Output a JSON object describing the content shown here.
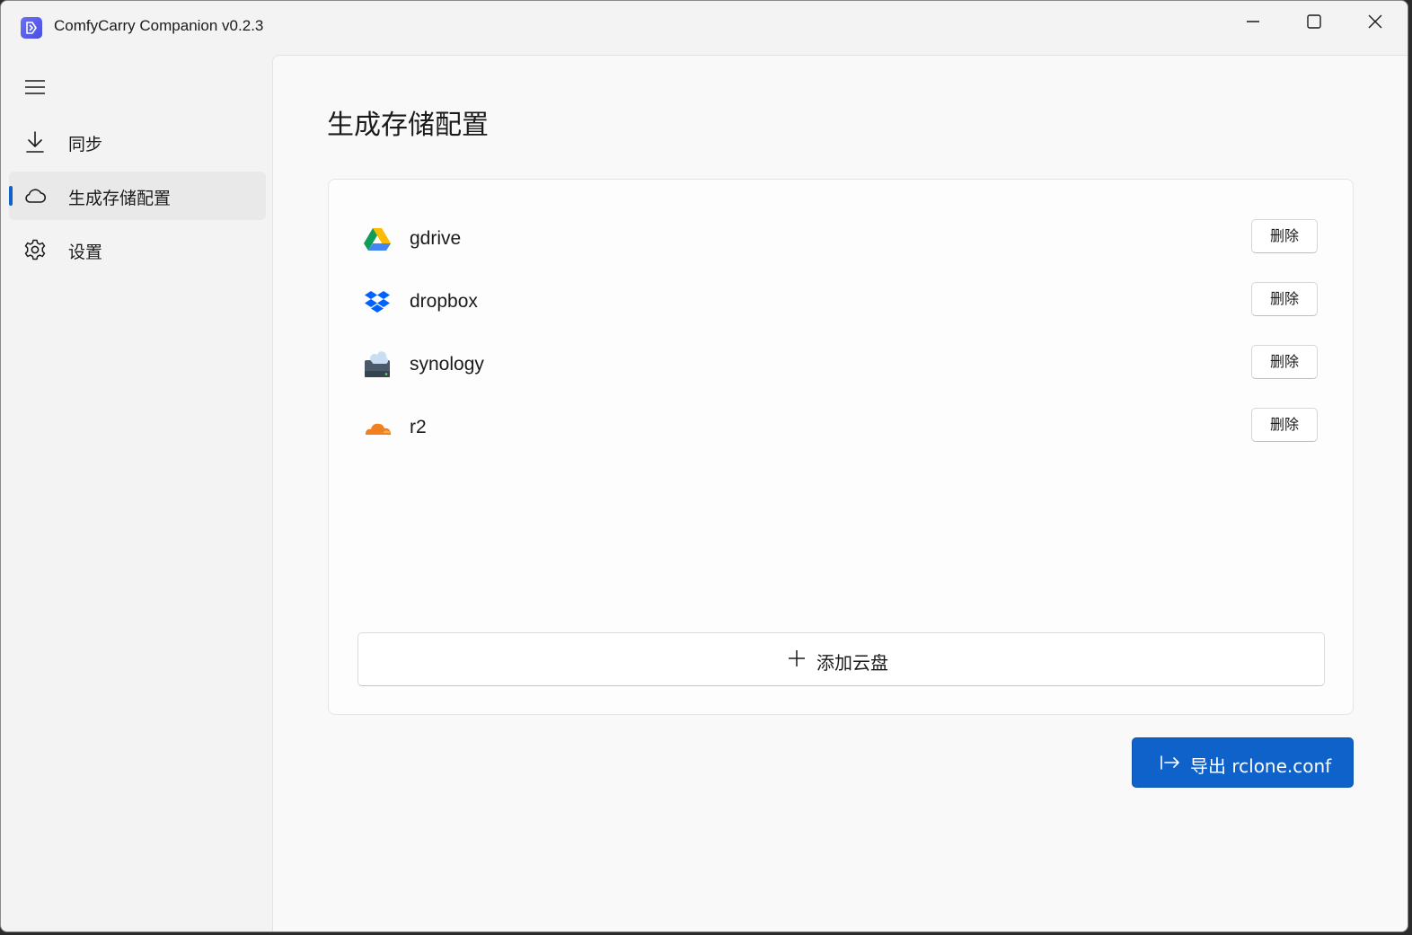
{
  "window": {
    "title": "ComfyCarry Companion v0.2.3"
  },
  "sidebar": {
    "items": [
      {
        "label": "同步",
        "icon": "download-icon",
        "active": false
      },
      {
        "label": "生成存储配置",
        "icon": "cloud-icon",
        "active": true
      },
      {
        "label": "设置",
        "icon": "gear-icon",
        "active": false
      }
    ]
  },
  "main": {
    "title": "生成存储配置",
    "remotes": [
      {
        "name": "gdrive",
        "icon": "google-drive-icon",
        "delete_label": "删除"
      },
      {
        "name": "dropbox",
        "icon": "dropbox-icon",
        "delete_label": "删除"
      },
      {
        "name": "synology",
        "icon": "synology-nas-icon",
        "delete_label": "删除"
      },
      {
        "name": "r2",
        "icon": "cloudflare-icon",
        "delete_label": "删除"
      }
    ],
    "add_label": "添加云盘",
    "export_label": "导出 rclone.conf"
  },
  "colors": {
    "accent": "#0f62c9",
    "background": "#f3f3f3",
    "content_background": "#f9f9f9"
  }
}
